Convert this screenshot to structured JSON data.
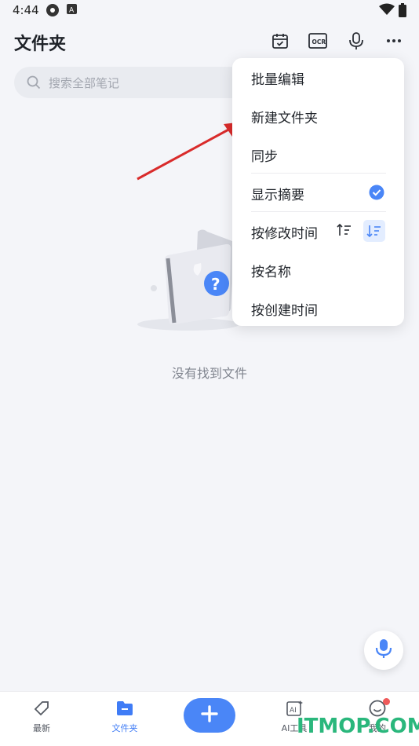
{
  "status_bar": {
    "time": "4:44",
    "icons": [
      "app-icon",
      "keyboard-a-icon",
      "wifi-icon",
      "battery-icon"
    ]
  },
  "header": {
    "title": "文件夹",
    "actions": [
      "calendar-check-icon",
      "ocr-icon",
      "mic-icon",
      "more-icon"
    ],
    "ocr_label": "OCR"
  },
  "search": {
    "placeholder": "搜索全部笔记"
  },
  "empty_state": {
    "message": "没有找到文件"
  },
  "menu": {
    "items": [
      {
        "label": "批量编辑"
      },
      {
        "label": "新建文件夹"
      },
      {
        "label": "同步"
      },
      {
        "label": "显示摘要",
        "checked": true
      },
      {
        "label": "按修改时间",
        "sort_desc_selected": true
      },
      {
        "label": "按名称"
      },
      {
        "label": "按创建时间"
      }
    ]
  },
  "bottom_nav": {
    "items": [
      {
        "label": "最新",
        "icon": "tag-icon"
      },
      {
        "label": "文件夹",
        "icon": "folder-icon",
        "active": true
      },
      {
        "label": "AI工具",
        "icon": "ai-icon"
      },
      {
        "label": "我的",
        "icon": "smile-icon",
        "badge": true
      }
    ]
  },
  "watermark": "ITMOP.COM",
  "colors": {
    "accent": "#4a86f7",
    "background": "#f4f5f9",
    "watermark": "#2ab77c",
    "arrow": "#d92b2b"
  }
}
